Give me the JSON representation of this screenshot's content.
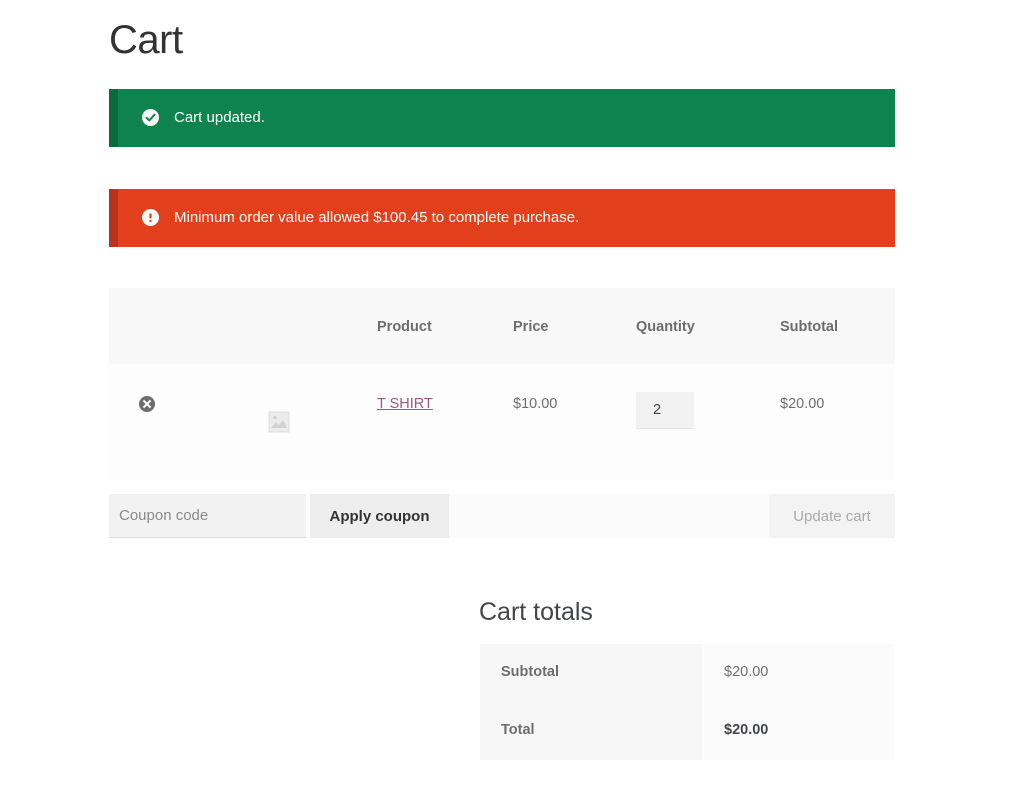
{
  "page": {
    "title": "Cart"
  },
  "notices": {
    "success": {
      "message": "Cart updated.",
      "color": "#0f834d",
      "icon": "check-circle-icon"
    },
    "error": {
      "message": "Minimum order value allowed $100.45 to complete purchase.",
      "color": "#e2401c",
      "icon": "exclamation-circle-icon"
    }
  },
  "cart_table": {
    "headers": {
      "product": "Product",
      "price": "Price",
      "quantity": "Quantity",
      "subtotal": "Subtotal"
    },
    "items": [
      {
        "name": "T SHIRT",
        "price": "$10.00",
        "quantity": "2",
        "subtotal": "$20.00",
        "thumbnail_icon": "image-placeholder-icon",
        "remove_icon": "remove-circle-icon"
      }
    ]
  },
  "actions": {
    "coupon_placeholder": "Coupon code",
    "apply_coupon_label": "Apply coupon",
    "update_cart_label": "Update cart"
  },
  "totals": {
    "title": "Cart totals",
    "subtotal_label": "Subtotal",
    "subtotal_value": "$20.00",
    "total_label": "Total",
    "total_value": "$20.00"
  },
  "colors": {
    "link": "#96588a",
    "text": "#43454b"
  }
}
